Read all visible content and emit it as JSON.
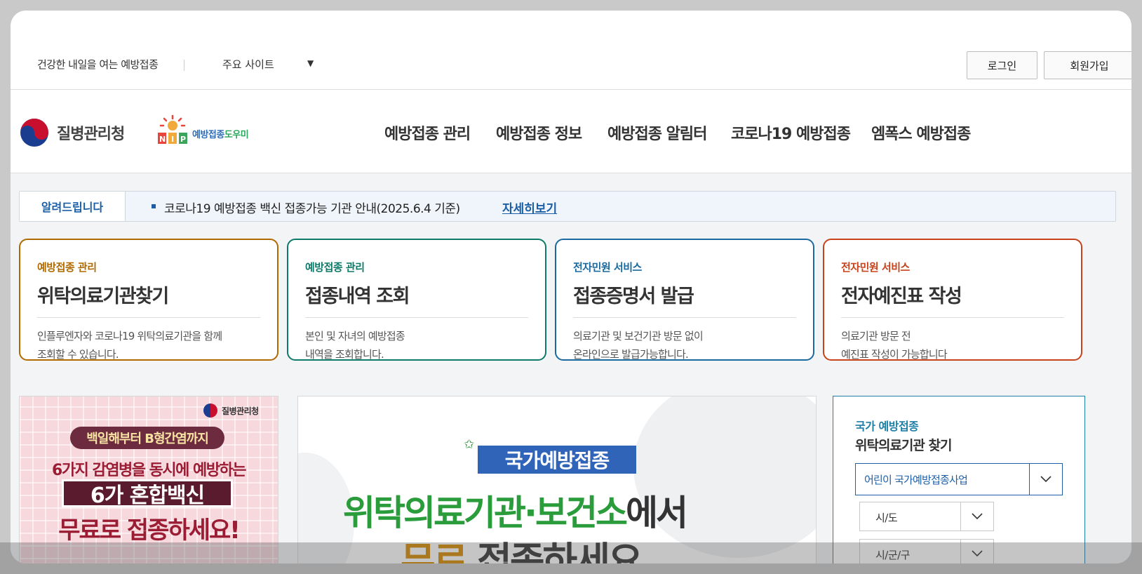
{
  "header": {
    "tagline": "건강한 내일을 여는 예방접종",
    "site_select": "주요 사이트",
    "login": "로그인",
    "signup": "회원가입"
  },
  "logos": {
    "kdca": "질병관리청",
    "nip_a": "예방접종",
    "nip_b": "도우미"
  },
  "nav": [
    "예방접종 관리",
    "예방접종 정보",
    "예방접종 알림터",
    "코로나19 예방접종",
    "엠폭스 예방접종"
  ],
  "notice": {
    "label": "알려드립니다",
    "text": "코로나19 예방접종 백신 접종가능 기관 안내(2025.6.4 기준)",
    "link": "자세히보기"
  },
  "cards": [
    {
      "category": "예방접종 관리",
      "title": "위탁의료기관찾기",
      "desc1": "인플루엔자와 코로나19 위탁의료기관을 함께",
      "desc2": "조회할 수 있습니다.",
      "color": "#b06a00"
    },
    {
      "category": "예방접종 관리",
      "title": "접종내역 조회",
      "desc1": "본인 및 자녀의 예방접종",
      "desc2": "내역을 조회합니다.",
      "color": "#0d7a6a"
    },
    {
      "category": "전자민원 서비스",
      "title": "접종증명서 발급",
      "desc1": "의료기관 및 보건기관 방문 없이",
      "desc2": "온라인으로 발급가능합니다.",
      "color": "#1a6aa0"
    },
    {
      "category": "전자민원 서비스",
      "title": "전자예진표 작성",
      "desc1": "의료기관 방문 전",
      "desc2": "예진표 작성이 가능합니다",
      "color": "#c8431c"
    }
  ],
  "banner_left": {
    "logo": "질병관리청",
    "pill": "백일해부터 B형간염까지",
    "line1": "6가지 감염병을 동시에 예방하는",
    "box": "6가 혼합백신",
    "line3": "무료로 접종하세요!"
  },
  "banner_center": {
    "pill": "국가예방접종",
    "line1_green": "위탁의료기관·보건소",
    "line1_dark": "에서",
    "line2_orange": "무료",
    "line2_dark": " 접종하세요"
  },
  "finder": {
    "subtitle": "국가 예방접종",
    "title": "위탁의료기관 찾기",
    "program": "어린이 국가예방접종사업",
    "sido": "시/도",
    "sigungu": "시/군/구"
  }
}
